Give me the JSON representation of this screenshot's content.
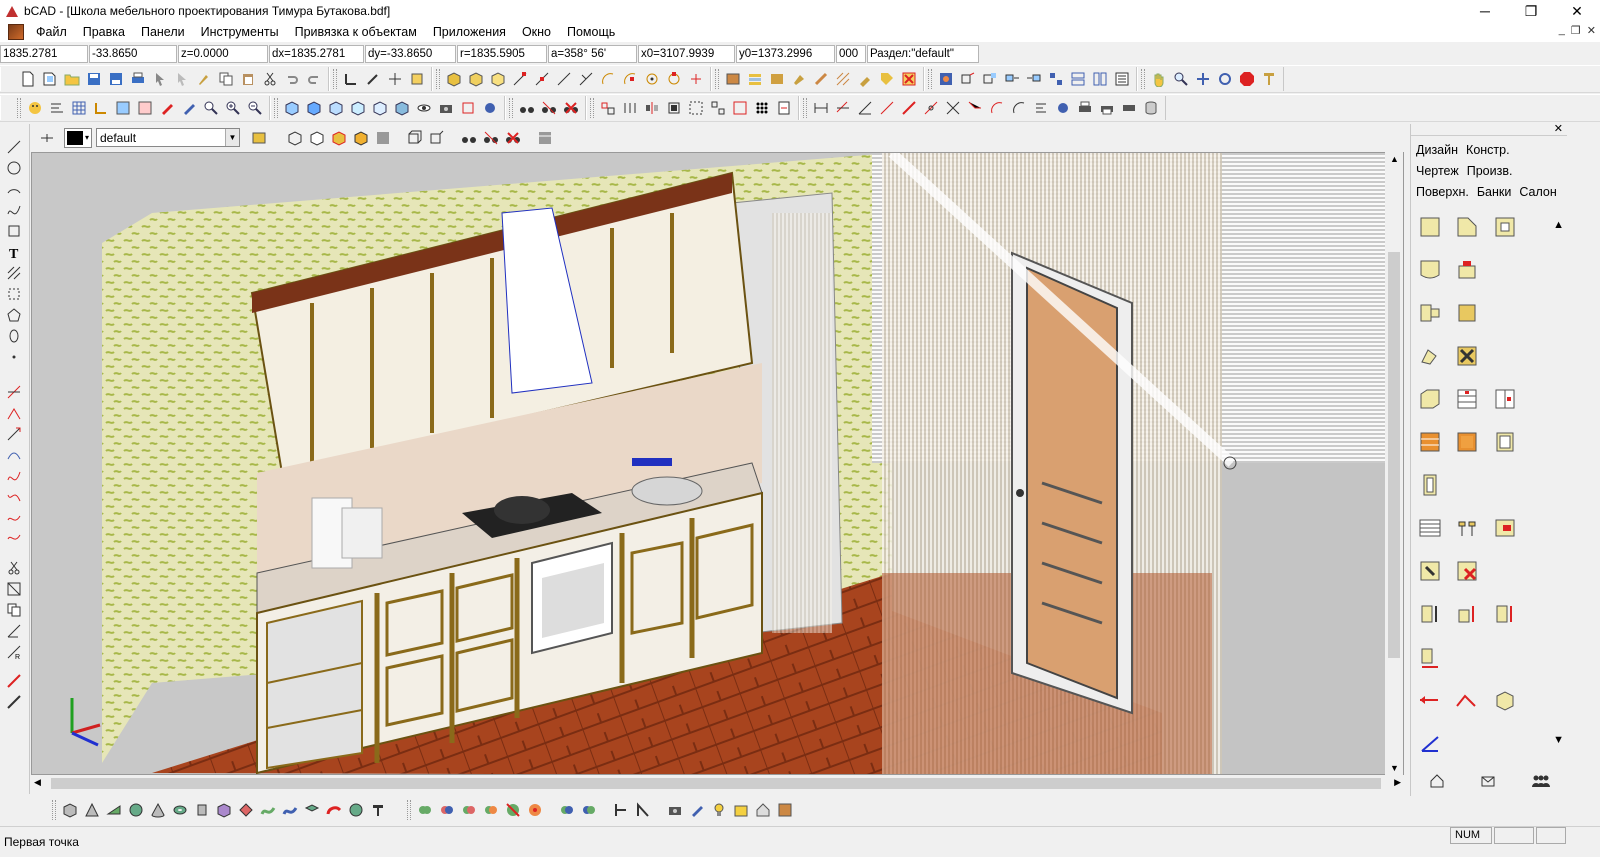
{
  "window": {
    "title": "bCAD - [Школа мебельного проектирования Тимура Бутакова.bdf]",
    "controls": {
      "minimize": "─",
      "maximize": "❐",
      "close": "✕"
    }
  },
  "menu": {
    "items": [
      "Файл",
      "Правка",
      "Панели",
      "Инструменты",
      "Привязка к объектам",
      "Приложения",
      "Окно",
      "Помощь"
    ],
    "mdi": {
      "minimize": "_",
      "restore": "❐",
      "close": "✕"
    }
  },
  "coords": {
    "x": "1835.2781",
    "y": "-33.8650",
    "z": "z=0.0000",
    "dx": "dx=1835.2781",
    "dy": "dy=-33.8650",
    "r": "r=1835.5905",
    "a": "a=358° 56'",
    "x0": "x0=3107.9939",
    "y0": "y0=1373.2996",
    "code": "000",
    "section": "Раздел:\"default\""
  },
  "layer": {
    "value": "default"
  },
  "right_panel": {
    "tabs": [
      "Дизайн",
      "Констр.",
      "Чертеж",
      "Произв.",
      "Поверхн.",
      "Банки",
      "Салон"
    ]
  },
  "status": {
    "hint": "Первая точка",
    "num": "NUM"
  },
  "colors": {
    "wallpaper": "#d9dca0",
    "floor": "#9a3a1e",
    "cabinet": "#f3efe6",
    "trim": "#8a6a1a",
    "axis_x": "#d02020",
    "axis_y": "#20a020",
    "axis_z": "#2030d0"
  }
}
